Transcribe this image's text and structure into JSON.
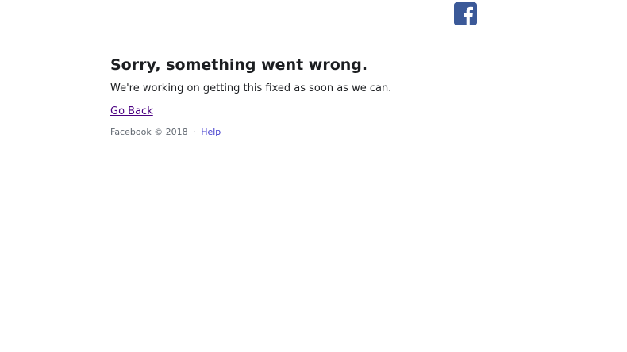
{
  "header": {
    "logo_icon": "facebook-f-icon",
    "logo_color": "#3b5998"
  },
  "error": {
    "title": "Sorry, something went wrong.",
    "message": "We're working on getting this fixed as soon as we can.",
    "back_link": "Go Back"
  },
  "footer": {
    "copyright": "Facebook © 2018",
    "separator": "·",
    "help_link": "Help"
  }
}
